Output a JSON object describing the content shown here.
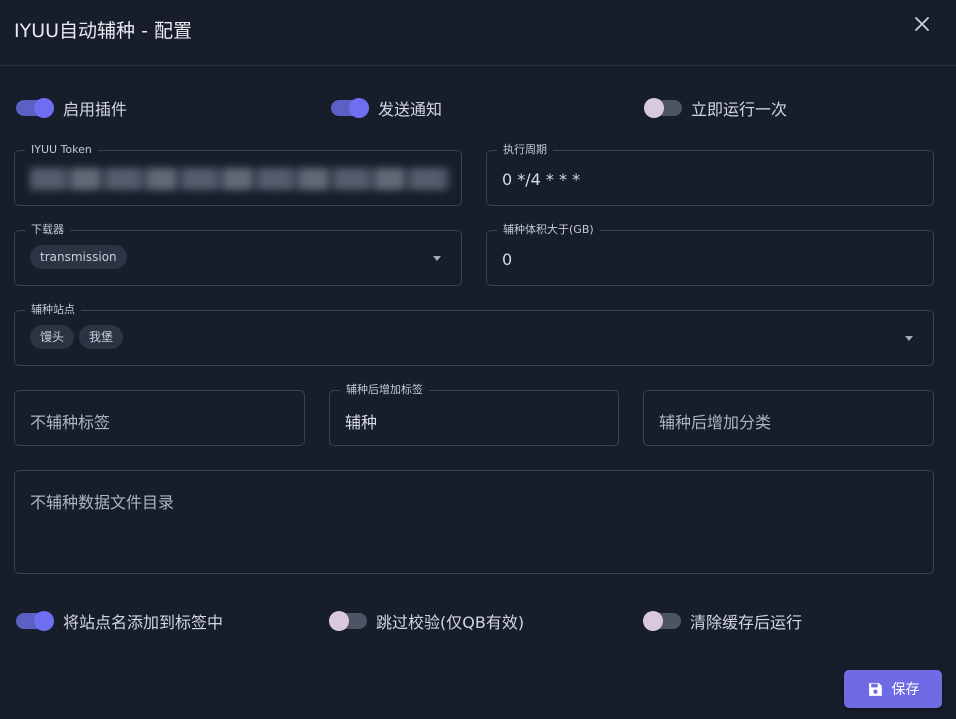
{
  "dialog": {
    "title": "IYUU自动辅种 - 配置"
  },
  "switches_top": [
    {
      "label": "启用插件",
      "checked": true
    },
    {
      "label": "发送通知",
      "checked": true
    },
    {
      "label": "立即运行一次",
      "checked": false
    }
  ],
  "fields": {
    "token": {
      "label": "IYUU Token",
      "value_masked": true
    },
    "cron": {
      "label": "执行周期",
      "value": "0 */4 * * *"
    },
    "downloader": {
      "label": "下载器",
      "chips": [
        "transmission"
      ]
    },
    "size": {
      "label": "辅种体积大于(GB)",
      "value": "0"
    },
    "sites": {
      "label": "辅种站点",
      "chips": [
        "馒头",
        "我堡"
      ]
    },
    "exclude_tags": {
      "placeholder": "不辅种标签"
    },
    "add_tag": {
      "label": "辅种后增加标签",
      "value": "辅种"
    },
    "add_category": {
      "placeholder": "辅种后增加分类"
    },
    "exclude_paths": {
      "placeholder": "不辅种数据文件目录"
    }
  },
  "switches_bottom": [
    {
      "label": "将站点名添加到标签中",
      "checked": true
    },
    {
      "label": "跳过校验(仅QB有效)",
      "checked": false
    },
    {
      "label": "清除缓存后运行",
      "checked": false
    }
  ],
  "actions": {
    "save_label": "保存"
  },
  "colors": {
    "background": "#171d2b",
    "accent": "#6f6be5",
    "border": "#3b4254",
    "switch_on": "#6e6ef0",
    "switch_off_knob": "#d8c9dd"
  },
  "icons": {
    "close": "close-icon",
    "save": "floppy-disk-icon",
    "dropdown": "caret-down-icon"
  }
}
